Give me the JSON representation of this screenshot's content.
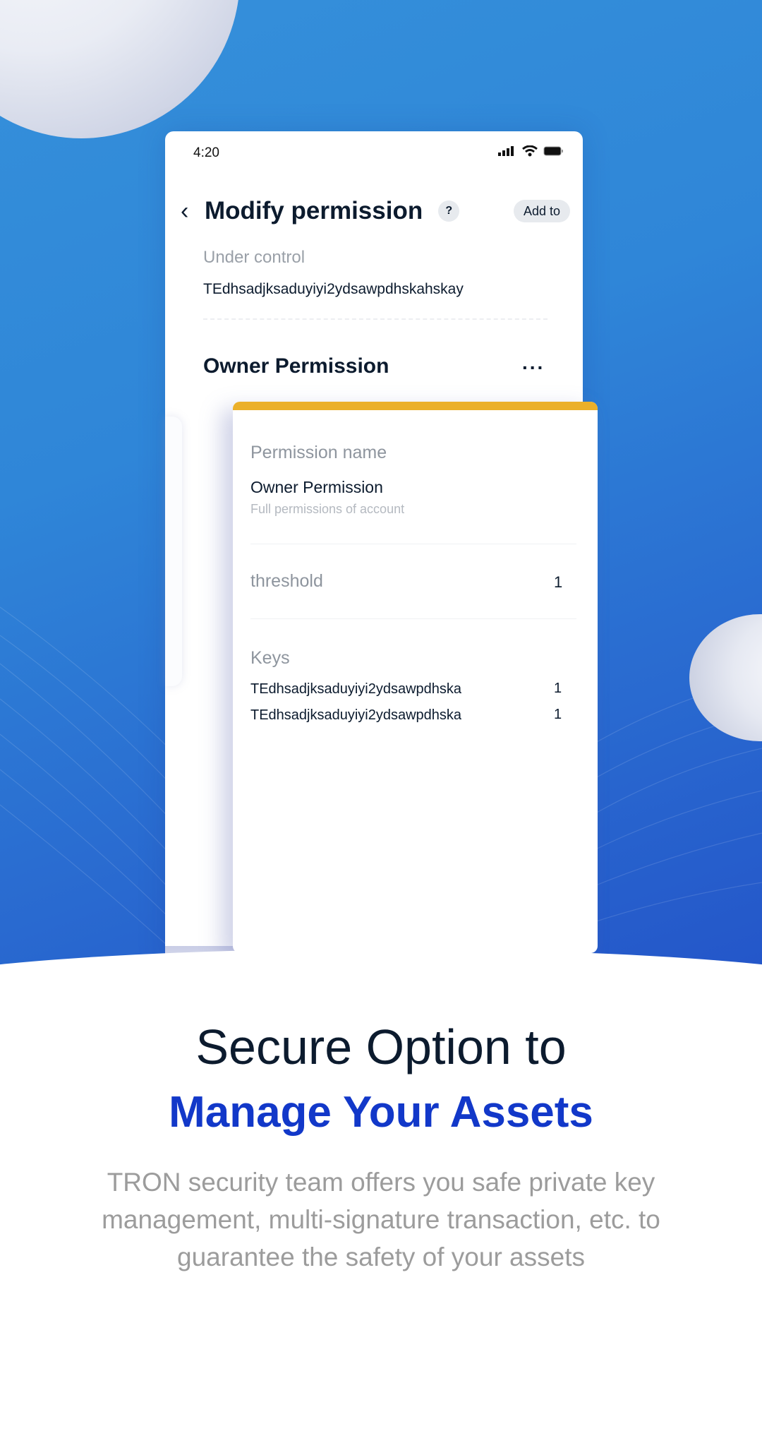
{
  "status_bar": {
    "time": "4:20",
    "icons": [
      "signal-icon",
      "wifi-icon",
      "battery-icon"
    ]
  },
  "header": {
    "back_icon": "chevron-left-icon",
    "title": "Modify permission",
    "help_label": "?",
    "add_button": "Add to"
  },
  "under_control": {
    "label": "Under control",
    "address": "TEdhsadjksaduyiyi2ydsawpdhskahskay"
  },
  "section": {
    "title": "Owner Permission",
    "more_label": "..."
  },
  "permission_card": {
    "accent_color": "#EBB02A",
    "name_label": "Permission name",
    "name_value": "Owner Permission",
    "name_desc": "Full permissions of account",
    "threshold_label": "threshold",
    "threshold_value": "1",
    "keys_label": "Keys",
    "keys": [
      {
        "address": "TEdhsadjksaduyiyi2ydsawpdhska",
        "weight": "1"
      },
      {
        "address": "TEdhsadjksaduyiyi2ydsawpdhska",
        "weight": "1"
      }
    ]
  },
  "promo": {
    "headline_line1": "Secure Option to",
    "headline_line2": "Manage Your Assets",
    "highlight_color": "#1238C9",
    "body": "TRON security team offers you safe private key management, multi-signature transaction, etc. to guarantee the safety of your assets"
  }
}
